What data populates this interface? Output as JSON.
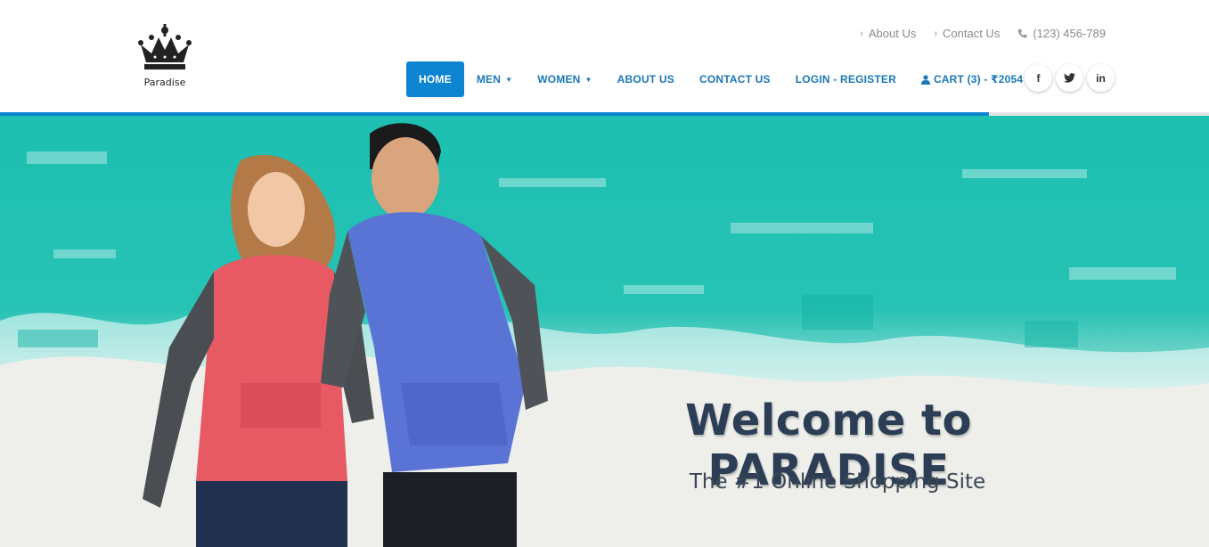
{
  "brand": {
    "name": "Paradise",
    "logo_icon": "crown-icon"
  },
  "top_links": [
    {
      "label": "About Us",
      "icon": "chevron-right-icon"
    },
    {
      "label": "Contact Us",
      "icon": "chevron-right-icon"
    },
    {
      "label": "(123) 456-789",
      "icon": "phone-icon"
    }
  ],
  "nav": {
    "home": "HOME",
    "men": "MEN",
    "women": "WOMEN",
    "about": "ABOUT US",
    "contact": "CONTACT US",
    "login": "LOGIN - REGISTER",
    "cart": "CART (3) - ₹2054"
  },
  "social": {
    "facebook": "f",
    "twitter": "t",
    "linkedin": "in"
  },
  "colors": {
    "accent": "#0d84cf",
    "nav_text": "#1a77b8",
    "hero_teal": "#1cbfb1",
    "title": "#2c3e55"
  },
  "hero": {
    "title": "Welcome to PARADISE",
    "subtitle": "The #1 Online Shopping Site"
  }
}
